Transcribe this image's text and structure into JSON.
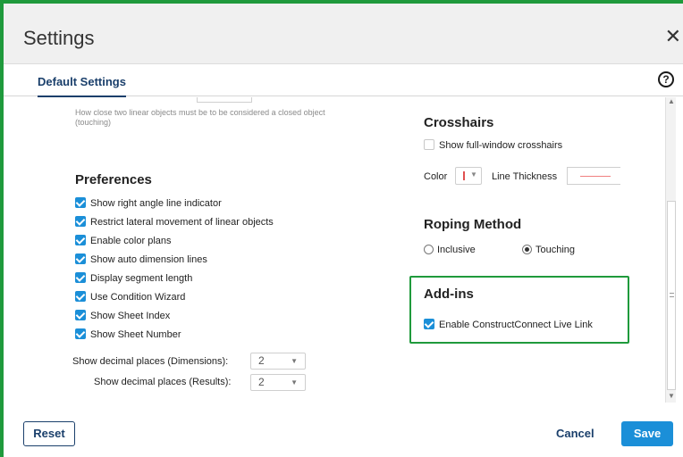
{
  "dialog": {
    "title": "Settings",
    "close_icon": "close-icon",
    "help_icon": "help-icon",
    "help_glyph": "?"
  },
  "tabs": [
    {
      "label": "Default Settings",
      "active": true
    }
  ],
  "closure": {
    "hint": "How close two linear objects must be to be considered a closed object (touching)"
  },
  "preferences": {
    "heading": "Preferences",
    "items": [
      {
        "label": "Show right angle line indicator",
        "checked": true
      },
      {
        "label": "Restrict lateral movement of linear objects",
        "checked": true
      },
      {
        "label": "Enable color plans",
        "checked": true
      },
      {
        "label": "Show auto dimension lines",
        "checked": true
      },
      {
        "label": "Display segment length",
        "checked": true
      },
      {
        "label": "Use Condition Wizard",
        "checked": true
      },
      {
        "label": "Show Sheet Index",
        "checked": true
      },
      {
        "label": "Show Sheet Number",
        "checked": true
      }
    ],
    "decimal_dimensions_label": "Show decimal places (Dimensions):",
    "decimal_dimensions_value": "2",
    "decimal_results_label": "Show decimal places (Results):",
    "decimal_results_value": "2"
  },
  "crosshairs": {
    "heading": "Crosshairs",
    "full_window_label": "Show full-window crosshairs",
    "full_window_checked": false,
    "color_label": "Color",
    "color_value": "#e05050",
    "thickness_label": "Line Thickness"
  },
  "roping": {
    "heading": "Roping Method",
    "options": [
      {
        "label": "Inclusive",
        "selected": false
      },
      {
        "label": "Touching",
        "selected": true
      }
    ]
  },
  "addins": {
    "heading": "Add-ins",
    "live_link_label": "Enable ConstructConnect Live Link",
    "live_link_checked": true
  },
  "footer": {
    "reset_label": "Reset",
    "cancel_label": "Cancel",
    "save_label": "Save"
  },
  "colors": {
    "accent": "#1b8fd8",
    "navy": "#1a3f6b",
    "highlight": "#1f9a3c"
  }
}
